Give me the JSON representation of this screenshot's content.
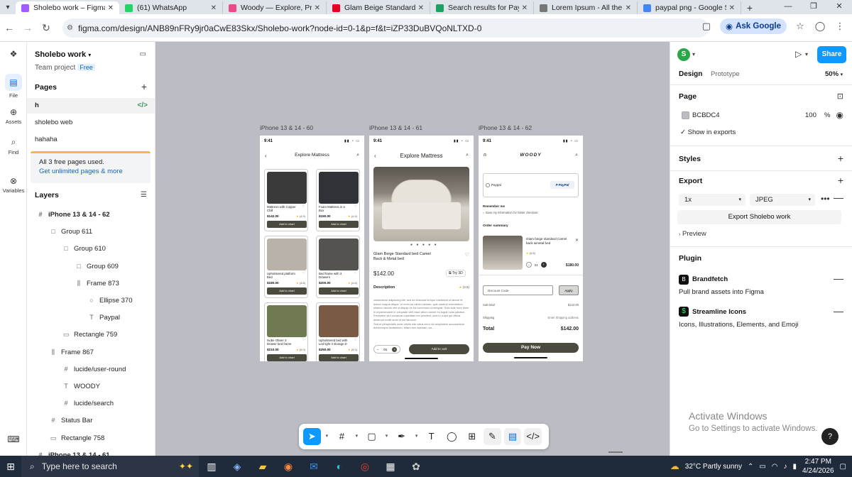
{
  "browser": {
    "tabs": [
      {
        "title": "Sholebo work – Figma",
        "color": "#a259ff",
        "active": true
      },
      {
        "title": "(61) WhatsApp",
        "color": "#25d366",
        "active": false
      },
      {
        "title": "Woody — Explore, Pro",
        "color": "#ea4c89",
        "active": false
      },
      {
        "title": "Glam Beige Standard B",
        "color": "#e60023",
        "active": false
      },
      {
        "title": "Search results for Payp",
        "color": "#1aa260",
        "active": false
      },
      {
        "title": "Lorem Ipsum - All the",
        "color": "#777777",
        "active": false
      },
      {
        "title": "paypal png - Google S",
        "color": "#4285f4",
        "active": false
      }
    ],
    "url": "figma.com/design/ANB89nFRy9jr0aCwE83Skx/Sholebo-work?node-id=0-1&p=f&t=iZP33DuBVQoNLTXD-0",
    "ask_google": "Ask Google"
  },
  "rail": {
    "file": "File",
    "assets": "Assets",
    "find": "Find",
    "variables": "Variables"
  },
  "left": {
    "title": "Sholebo work",
    "team": "Team project",
    "plan": "Free",
    "pages_label": "Pages",
    "pages": [
      "h",
      "sholebo web",
      "hahaha"
    ],
    "note_title": "All 3 free pages used.",
    "note_link": "Get unlimited pages & more",
    "layers_label": "Layers",
    "layers": [
      {
        "name": "iPhone 13 & 14 - 62",
        "icon": "#",
        "indent": 0,
        "bold": true
      },
      {
        "name": "Group 611",
        "icon": "□",
        "indent": 1,
        "bold": false
      },
      {
        "name": "Group 610",
        "icon": "□",
        "indent": 2,
        "bold": false
      },
      {
        "name": "Group 609",
        "icon": "□",
        "indent": 3,
        "bold": false
      },
      {
        "name": "Frame 873",
        "icon": "⫼",
        "indent": 3,
        "bold": false
      },
      {
        "name": "Ellipse 370",
        "icon": "○",
        "indent": 4,
        "bold": false
      },
      {
        "name": "Paypal",
        "icon": "T",
        "indent": 4,
        "bold": false
      },
      {
        "name": "Rectangle 759",
        "icon": "▭",
        "indent": 2,
        "bold": false
      },
      {
        "name": "Frame 867",
        "icon": "⫼",
        "indent": 1,
        "bold": false
      },
      {
        "name": "lucide/user-round",
        "icon": "#",
        "indent": 2,
        "bold": false
      },
      {
        "name": "WOODY",
        "icon": "T",
        "indent": 2,
        "bold": false
      },
      {
        "name": "lucide/search",
        "icon": "#",
        "indent": 2,
        "bold": false
      },
      {
        "name": "Status Bar",
        "icon": "#",
        "indent": 1,
        "bold": false
      },
      {
        "name": "Rectangle 758",
        "icon": "▭",
        "indent": 1,
        "bold": false
      },
      {
        "name": "iPhone 13 & 14 - 61",
        "icon": "#",
        "indent": 0,
        "bold": true
      }
    ]
  },
  "canvas": {
    "frames": [
      "iPhone 13 & 14 - 60",
      "iPhone 13 & 14 - 61",
      "iPhone 13 & 14 - 62"
    ],
    "time": "9:41",
    "f60": {
      "title": "Explore Mattress",
      "products": [
        {
          "name": "Mattress with Copper Chill",
          "price": "$142.00",
          "rating": "(4.9)",
          "color": "#3a3a3a"
        },
        {
          "name": "Foam Mattress in a Box",
          "price": "$150.00",
          "rating": "(4.4)",
          "color": "#2f3338"
        },
        {
          "name": "Upholstered platform Bed",
          "price": "$180.00",
          "rating": "(4.8)",
          "color": "#b9b2a8"
        },
        {
          "name": "Bed frame with 3 Drawers",
          "price": "$200.00",
          "rating": "(4.6)",
          "color": "#55534f"
        },
        {
          "name": "Isobe Olivier 3 Drawer bed frame",
          "price": "$210.00",
          "rating": "(5.0)",
          "color": "#6f7a52"
        },
        {
          "name": "Upholstered bed with Led light 4 storage D",
          "price": "$250.00",
          "rating": "(5.0)",
          "color": "#7a5a45"
        }
      ],
      "add_to_chart": "Add to chart"
    },
    "f61": {
      "title": "Explore Mattress",
      "product": "Glam Beige Standard bed Camel Back & Metal bed",
      "price": "$142.00",
      "try3d": "Try 3D",
      "desc_label": "Description",
      "rating": "(4.6)",
      "desc": "consectetur adipiscing elit, sed do eiusmod tempor incididunt ut labore et dolore magna aliqua. Ut enim ad minim veniam, quis nostrud exercitation ullamco laboris nisi ut aliquip ex ea commodo consequat. Duis aute irure dolor in reprehenderit in voluptate velit esse cillum dolore eu fugiat nulla pariatur. Excepteur sint occaecat cupidatat non proident, sunt in culpa qui officia deserunt mollit anim id est laborum",
      "desc2": "Sed ut perspiciatis unde omnis iste natus error sit voluptatem accusantium doloremque laudantium, totam rem aperiam, ea...",
      "qty": "01",
      "add_btn": "Add to cart"
    },
    "f62": {
      "brand": "WOODY",
      "paypal": "Paypal",
      "paypal_logo": "PayPal",
      "remember": "Remember me",
      "save_info": "Save my information for faster checkout",
      "summary": "Order summary",
      "item": "Glam beige standard Camel back &metal bed",
      "item_rating": "(4.8)",
      "qty": "01",
      "item_price": "$180.00",
      "discount": "Discount Code",
      "apply": "Apply",
      "subtotal_label": "Sub-total",
      "subtotal": "$142.00",
      "shipping_label": "Shipping",
      "shipping": "Enter Shipping address",
      "total_label": "Total",
      "total": "$142.00",
      "pay": "Pay Now"
    }
  },
  "right": {
    "avatar": "S",
    "share": "Share",
    "tab_design": "Design",
    "tab_proto": "Prototype",
    "zoom": "50%",
    "page_label": "Page",
    "page_color": "BCBDC4",
    "page_opacity": "100",
    "percent": "%",
    "show_exports": "Show in exports",
    "styles": "Styles",
    "export": "Export",
    "scale": "1x",
    "format": "JPEG",
    "export_btn": "Export Sholebo work",
    "preview": "Preview",
    "plugin": "Plugin",
    "brandfetch": "Brandfetch",
    "brandfetch_desc": "Pull brand assets into Figma",
    "streamline": "Streamline Icons",
    "streamline_desc": "Icons, Illustrations, Elements, and Emoji"
  },
  "windows": {
    "activate": "Activate Windows",
    "activate_sub": "Go to Settings to activate Windows.",
    "search": "Type here to search",
    "weather": "32°C  Partly sunny",
    "time": "2:47 PM",
    "date": "4/24/2026"
  }
}
